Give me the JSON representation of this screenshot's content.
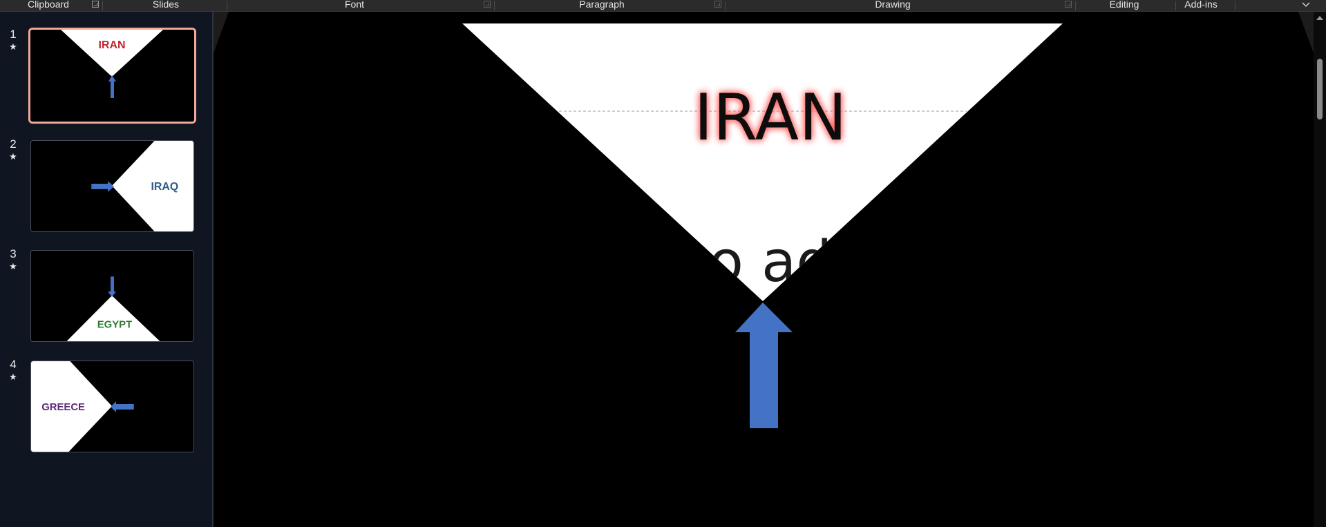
{
  "ribbon": {
    "groups": [
      {
        "label": "Clipboard"
      },
      {
        "label": "Slides"
      },
      {
        "label": "Font"
      },
      {
        "label": "Paragraph"
      },
      {
        "label": "Drawing"
      },
      {
        "label": "Editing"
      },
      {
        "label": "Add-ins"
      }
    ],
    "launcher_icon": "dialog-launcher-icon",
    "collapse_icon": "chevron-down-icon"
  },
  "slides": [
    {
      "number": "1",
      "star": "★",
      "label": "IRAN",
      "label_color": "#c0282e",
      "selected": true
    },
    {
      "number": "2",
      "star": "★",
      "label": "IRAQ",
      "label_color": "#2e5c8a",
      "selected": false
    },
    {
      "number": "3",
      "star": "★",
      "label": "EGYPT",
      "label_color": "#2f7a38",
      "selected": false
    },
    {
      "number": "4",
      "star": "★",
      "label": "GREECE",
      "label_color": "#5a2b7a",
      "selected": false
    }
  ],
  "canvas": {
    "title": "IRAN",
    "title_color": "#0b0b0b",
    "title_glow_color": "#ff5d5d",
    "placeholder_fragment": "o ad",
    "arrow_color": "#4472c4",
    "shape_fill": "#ffffff",
    "slide_background": "#000000"
  },
  "colors": {
    "selection_border": "#f4a89a",
    "pane_background": "#101621"
  }
}
